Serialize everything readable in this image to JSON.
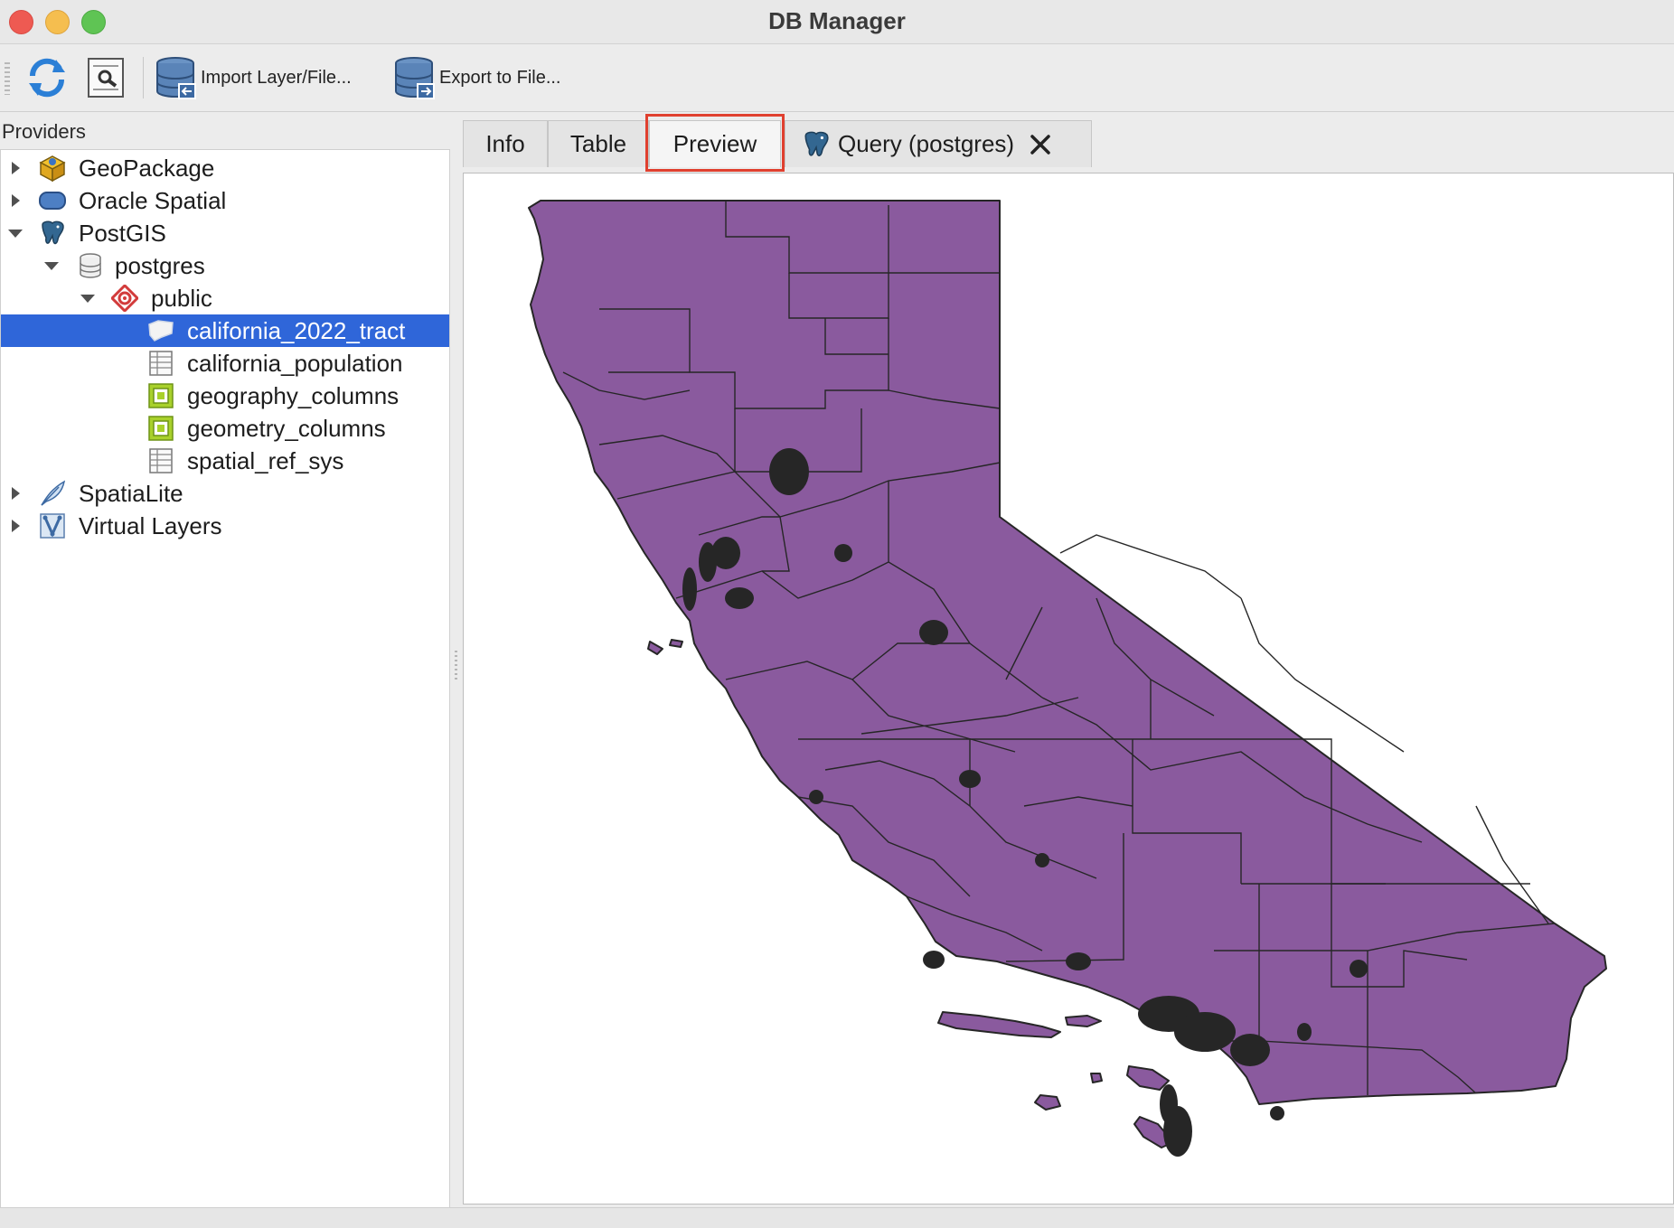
{
  "window": {
    "title": "DB Manager"
  },
  "toolbar": {
    "refresh_icon": "refresh-icon",
    "info_icon": "sql-window-icon",
    "import_label": "Import Layer/File...",
    "export_label": "Export to File..."
  },
  "left_panel": {
    "label": "Providers",
    "items": [
      {
        "label": "GeoPackage",
        "icon": "geopackage-icon",
        "expanded": false
      },
      {
        "label": "Oracle Spatial",
        "icon": "oracle-icon",
        "expanded": false
      },
      {
        "label": "PostGIS",
        "icon": "postgis-elephant-icon",
        "expanded": true
      },
      {
        "label": "postgres",
        "icon": "database-icon",
        "expanded": true
      },
      {
        "label": "public",
        "icon": "schema-icon",
        "expanded": true
      },
      {
        "label": "california_2022_tract",
        "icon": "polygon-layer-icon",
        "selected": true
      },
      {
        "label": "california_population",
        "icon": "table-icon"
      },
      {
        "label": "geography_columns",
        "icon": "view-icon"
      },
      {
        "label": "geometry_columns",
        "icon": "view-icon"
      },
      {
        "label": "spatial_ref_sys",
        "icon": "table-icon"
      },
      {
        "label": "SpatiaLite",
        "icon": "spatialite-feather-icon",
        "expanded": false
      },
      {
        "label": "Virtual Layers",
        "icon": "virtual-layer-icon",
        "expanded": false
      }
    ]
  },
  "tabs": [
    {
      "label": "Info"
    },
    {
      "label": "Table"
    },
    {
      "label": "Preview",
      "active": true
    },
    {
      "label": "Query (postgres)",
      "icon": "postgis-elephant-icon",
      "closable": true
    }
  ],
  "preview": {
    "layer": "california_2022_tract",
    "fill_color": "#8a5a9e",
    "outline_color": "#262626",
    "highlight_color": "#e0402f"
  }
}
